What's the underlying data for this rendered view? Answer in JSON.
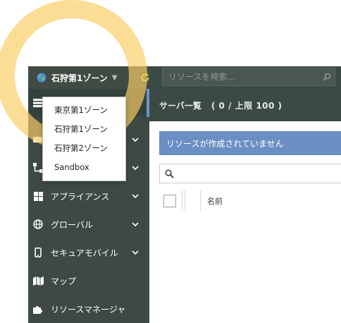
{
  "topbar": {
    "zone_name": "石狩第1ゾーン",
    "search_placeholder": "リソースを検索..."
  },
  "zone_menu": {
    "options": [
      "東京第1ゾーン",
      "石狩第1ゾーン",
      "石狩第2ゾーン",
      "Sandbox"
    ]
  },
  "sidebar": {
    "items": [
      {
        "label": "",
        "icon": "list-icon",
        "active": true
      },
      {
        "label": "",
        "icon": "server-icon",
        "expandable": true
      },
      {
        "label": "",
        "icon": "network-icon",
        "expandable": true
      },
      {
        "label": "アプライアンス",
        "icon": "appliance-icon",
        "expandable": true
      },
      {
        "label": "グローバル",
        "icon": "globe-icon",
        "expandable": true
      },
      {
        "label": "セキュアモバイル",
        "icon": "mobile-icon",
        "expandable": true
      },
      {
        "label": "マップ",
        "icon": "map-icon"
      },
      {
        "label": "リソースマネージャ",
        "icon": "puzzle-icon"
      }
    ]
  },
  "main": {
    "list_title": "サーバ一覧",
    "list_count": "( 0 / 上限 100 )",
    "empty_message": "リソースが作成されていません",
    "filter_placeholder": "",
    "columns": [
      "名前"
    ]
  },
  "colors": {
    "sidebar_bg": "#3f4944",
    "topbar_bg": "#3a4a44",
    "accent_blue": "#6b8fc4",
    "refresh_green": "#a6c94a",
    "highlight_ring": "#facd64"
  }
}
